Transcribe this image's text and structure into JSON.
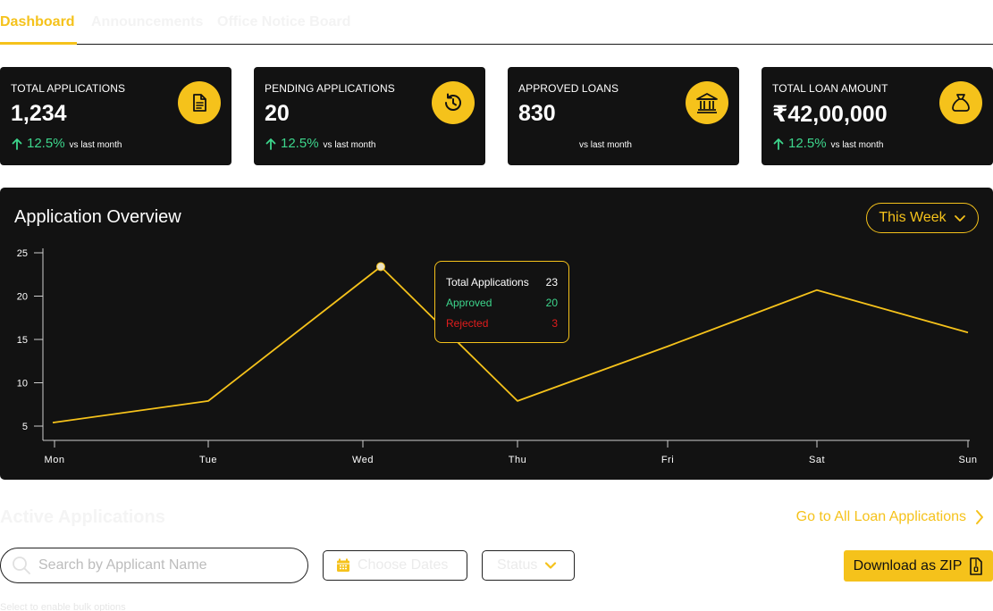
{
  "tabs": [
    {
      "label": "Dashboard",
      "active": true
    },
    {
      "label": "Announcements",
      "active": false
    },
    {
      "label": "Office Notice Board",
      "active": false
    }
  ],
  "cards": [
    {
      "title": "TOTAL APPLICATIONS",
      "value": "1,234",
      "trend": "12.5%",
      "note": "vs last month",
      "icon": "document-icon"
    },
    {
      "title": "PENDING APPLICATIONS",
      "value": "20",
      "trend": "12.5%",
      "note": "vs last month",
      "icon": "history-icon"
    },
    {
      "title": "APPROVED LOANS",
      "value": "830",
      "trend": "",
      "note": "vs last month",
      "icon": "bank-icon"
    },
    {
      "title": "TOTAL LOAN AMOUNT",
      "value": "₹42,00,000",
      "trend": "12.5%",
      "note": "vs last month",
      "icon": "money-bag-icon"
    }
  ],
  "overview": {
    "title": "Application Overview",
    "range_label": "This Week"
  },
  "chart_data": {
    "type": "line",
    "categories": [
      "Mon",
      "Tue",
      "Wed",
      "Thu",
      "Fri",
      "Sat",
      "Sun"
    ],
    "series": [
      {
        "values": [
          5.4,
          7.9,
          23.4,
          7.9,
          14.2,
          20.7,
          15.8
        ]
      }
    ],
    "y_ticks": [
      5,
      10,
      15,
      20,
      25
    ],
    "ylim": [
      3,
      26
    ],
    "line_color": "#f5c21b",
    "highlight_index": 2,
    "tooltip": {
      "total_label": "Total Applications",
      "total_value": "23",
      "approved_label": "Approved",
      "approved_value": "20",
      "rejected_label": "Rejected",
      "rejected_value": "3"
    }
  },
  "active": {
    "title": "Active Applications",
    "goto_label": "Go to All Loan Applications",
    "search_placeholder": "Search by Applicant Name",
    "date_label": "Choose Dates",
    "status_label": "Status",
    "download_label": "Download as ZIP",
    "bulk_note": "Select to enable bulk options"
  },
  "colors": {
    "accent": "#f5c21b",
    "positive": "#3dd68c",
    "negative": "#e11d1d",
    "panel": "#121212"
  }
}
